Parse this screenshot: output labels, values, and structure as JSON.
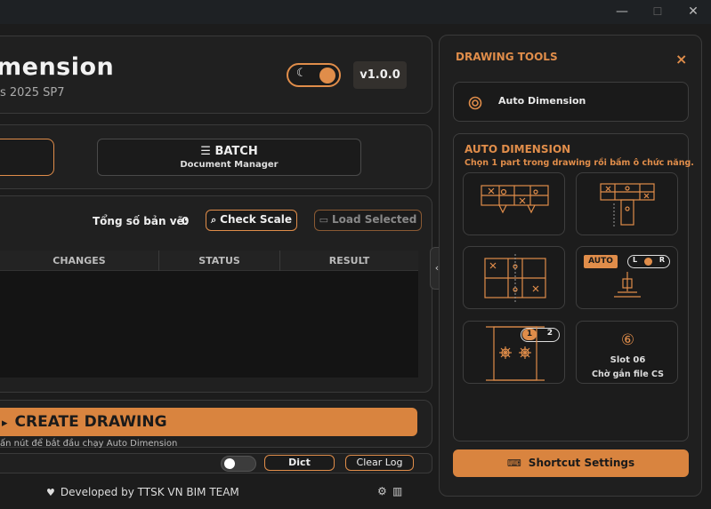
{
  "window": {
    "minimize": "—",
    "maximize": "☐",
    "close": "✕"
  },
  "header": {
    "title": "mension",
    "subtitle": "s 2025 SP7",
    "version": "v1.0.0"
  },
  "modes": {
    "batch_label": "☰  BATCH",
    "batch_sub": "Document Manager"
  },
  "summary": {
    "total_label": "Tổng số bản vẽ:",
    "total_value": "0",
    "check_scale": "Check Scale",
    "load_selected": "Load Selected"
  },
  "table": {
    "columns": [
      "CHANGES",
      "STATUS",
      "RESULT"
    ]
  },
  "actions": {
    "create_label": "CREATE DRAWING",
    "create_hint": "ấn nút để bắt đầu chạy Auto Dimension",
    "dict": "Dict",
    "clear_log": "Clear Log"
  },
  "footer": {
    "credit": "Developed by TTSK VN BIM TEAM"
  },
  "drawing_tools": {
    "title": "DRAWING TOOLS",
    "close": "×",
    "auto_dimension_button": "Auto Dimension",
    "section_title": "AUTO DIMENSION",
    "section_hint": "Chọn 1 part trong drawing rồi bấm ô chức năng.",
    "auto_badge": "AUTO",
    "lr_left": "L",
    "lr_right": "R",
    "step_one": "1",
    "step_two": "2",
    "slot_number": "⑥",
    "slot_label": "Slot 06",
    "slot_sub": "Chờ gắn file CS",
    "shortcut_settings": "Shortcut Settings"
  },
  "colors": {
    "accent": "#e08d4a",
    "background": "#1c1c1c",
    "panel": "#202020"
  }
}
